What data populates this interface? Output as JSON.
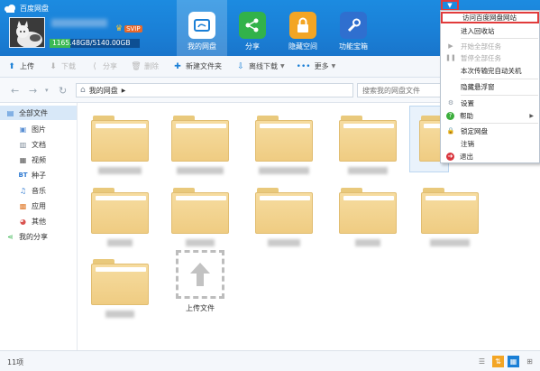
{
  "app": {
    "title": "百度网盘"
  },
  "user": {
    "vip_label": "SVIP",
    "quota_text": "1165.48GB/5140.00GB",
    "quota_used_fraction": 0.227
  },
  "nav": [
    {
      "label": "我的网盘",
      "icon": "cloud-icon",
      "active": true
    },
    {
      "label": "分享",
      "icon": "share-icon",
      "active": false
    },
    {
      "label": "隐藏空间",
      "icon": "lock-icon",
      "active": false
    },
    {
      "label": "功能宝箱",
      "icon": "wrench-icon",
      "active": false
    }
  ],
  "toolbar": {
    "upload": "上传",
    "download": "下载",
    "share": "分享",
    "delete": "删除",
    "new_folder": "新建文件夹",
    "offline_download": "离线下载",
    "more": "更多"
  },
  "address": {
    "crumb": "我的网盘",
    "search_placeholder": "搜索我的网盘文件"
  },
  "sidebar": {
    "items": [
      {
        "label": "全部文件",
        "icon": "folder-icon",
        "selected": true
      },
      {
        "label": "图片",
        "icon": "image-icon"
      },
      {
        "label": "文档",
        "icon": "document-icon"
      },
      {
        "label": "视频",
        "icon": "video-icon"
      },
      {
        "label": "种子",
        "icon": "bt-icon"
      },
      {
        "label": "音乐",
        "icon": "music-icon"
      },
      {
        "label": "应用",
        "icon": "app-icon"
      },
      {
        "label": "其他",
        "icon": "other-icon"
      },
      {
        "label": "我的分享",
        "icon": "share-icon"
      }
    ]
  },
  "files": {
    "upload_label": "上传文件",
    "count_label": "11项"
  },
  "menu": {
    "items": [
      {
        "label": "访问百度网盘网站",
        "highlighted": true
      },
      {
        "label": "进入回收站"
      },
      {
        "label": "开始全部任务",
        "disabled": true,
        "icon": "play-icon"
      },
      {
        "label": "暂停全部任务",
        "disabled": true,
        "icon": "pause-icon"
      },
      {
        "label": "本次传输完自动关机"
      },
      {
        "label": "隐藏悬浮窗"
      },
      {
        "label": "设置",
        "icon": "gear-icon"
      },
      {
        "label": "帮助",
        "icon": "help-icon",
        "submenu": true
      },
      {
        "label": "锁定网盘",
        "icon": "lock-icon"
      },
      {
        "label": "注销"
      },
      {
        "label": "退出",
        "icon": "exit-icon"
      }
    ]
  },
  "colors": {
    "header_blue": "#1a7fd6",
    "accent_red": "#e13b3b",
    "folder_yellow": "#f2d08a"
  }
}
